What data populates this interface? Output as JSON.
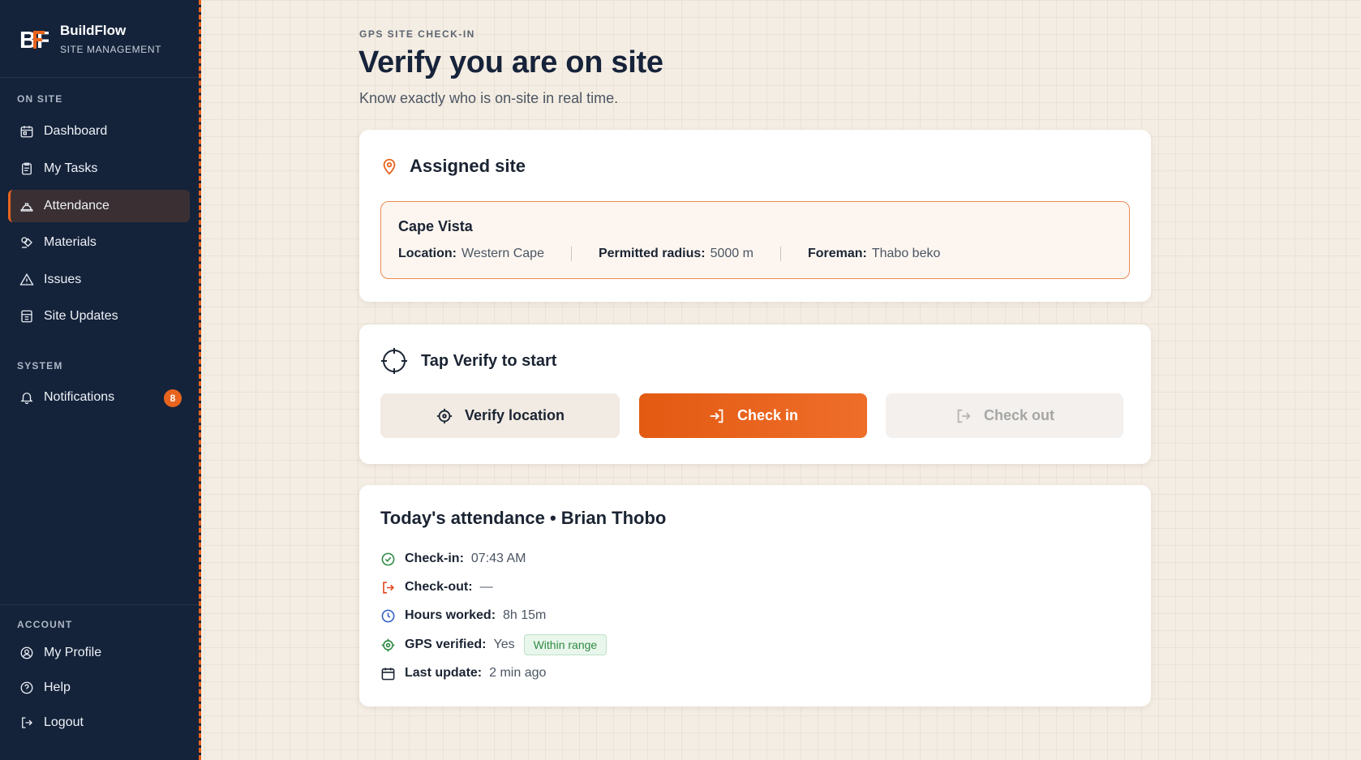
{
  "brand": {
    "logo_text": "BF",
    "title": "BuildFlow",
    "subtitle": "SITE MANAGEMENT"
  },
  "sidebar": {
    "sections": {
      "on_site": "ON SITE",
      "system": "SYSTEM",
      "account": "ACCOUNT"
    },
    "items": [
      {
        "label": "Dashboard",
        "icon": "dashboard-icon"
      },
      {
        "label": "My Tasks",
        "icon": "clipboard-icon"
      },
      {
        "label": "Attendance",
        "icon": "hard-hat-icon",
        "active": true
      },
      {
        "label": "Materials",
        "icon": "materials-icon"
      },
      {
        "label": "Issues",
        "icon": "warning-icon"
      },
      {
        "label": "Site Updates",
        "icon": "updates-icon"
      }
    ],
    "system_items": [
      {
        "label": "Notifications",
        "icon": "bell-icon",
        "badge": "8"
      }
    ],
    "account_items": [
      {
        "label": "My Profile",
        "icon": "profile-icon"
      },
      {
        "label": "Help",
        "icon": "help-icon"
      },
      {
        "label": "Logout",
        "icon": "logout-icon"
      }
    ]
  },
  "header": {
    "eyebrow": "GPS SITE CHECK-IN",
    "title": "Verify you are on site",
    "subtitle": "Know exactly who is on-site in real time."
  },
  "assigned_site": {
    "heading": "Assigned site",
    "name": "Cape Vista",
    "location_label": "Location:",
    "location_value": "Western Cape",
    "radius_label": "Permitted radius:",
    "radius_value": "5000 m",
    "foreman_label": "Foreman:",
    "foreman_value": "Thabo beko"
  },
  "verify": {
    "heading": "Tap Verify to start",
    "verify_label": "Verify location",
    "checkin_label": "Check in",
    "checkout_label": "Check out"
  },
  "attendance": {
    "title": "Today's attendance • Brian Thobo",
    "rows": [
      {
        "label": "Check-in:",
        "value": "07:43 AM"
      },
      {
        "label": "Check-out:",
        "value": "—"
      },
      {
        "label": "Hours worked:",
        "value": "8h 15m"
      },
      {
        "label": "GPS verified:",
        "value": "Yes",
        "pill": "Within range"
      },
      {
        "label": "Last update:",
        "value": "2 min ago"
      }
    ]
  },
  "colors": {
    "accent": "#e8641e",
    "sidebar_bg": "#14223a",
    "page_bg": "#f4ede3",
    "success": "#2e8a43",
    "danger": "#e0461b",
    "info": "#2f5fc4"
  }
}
